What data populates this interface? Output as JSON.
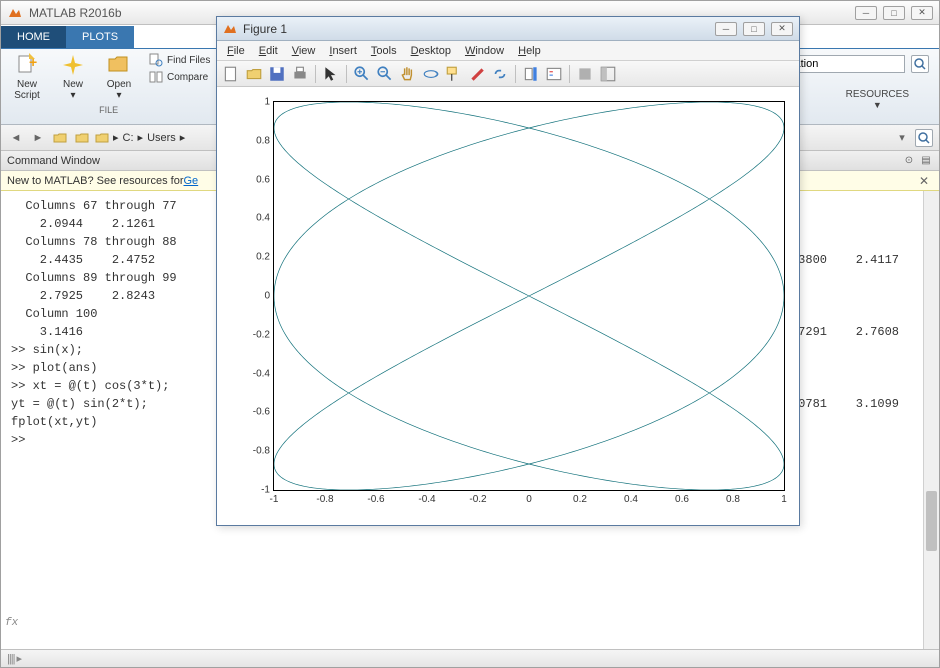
{
  "app": {
    "title": "MATLAB R2016b"
  },
  "tabs": {
    "home": "HOME",
    "plots": "PLOTS"
  },
  "toolstrip": {
    "new_script": "New\nScript",
    "new": "New",
    "open": "Open",
    "find_files": "Find Files",
    "compare": "Compare",
    "file_group": "FILE",
    "resources": "RESOURCES"
  },
  "search": {
    "placeholder": "mentation"
  },
  "nav": {
    "drive": "C:",
    "users": "Users"
  },
  "command_window": {
    "title": "Command Window",
    "hint_prefix": "New to MATLAB? See resources for ",
    "hint_link": "Ge",
    "lines": [
      "",
      "  Columns 67 through 77",
      "",
      "    2.0944    2.1261",
      "",
      "  Columns 78 through 88",
      "",
      "    2.4435    2.4752",
      "",
      "  Columns 89 through 99",
      "",
      "    2.7925    2.8243",
      "",
      "  Column 100",
      "",
      "    3.1416",
      "",
      ">> sin(x);",
      ">> plot(ans)",
      ">> xt = @(t) cos(3*t);",
      "yt = @(t) sin(2*t);",
      "fplot(xt,yt)",
      ">> "
    ],
    "right_values": [
      {
        "row": 3,
        "text": ".3800    2.4117"
      },
      {
        "row": 7,
        "text": ".7291    2.7608"
      },
      {
        "row": 11,
        "text": ".0781    3.1099"
      }
    ],
    "fx": "fx"
  },
  "figure": {
    "title": "Figure 1",
    "menus": [
      "File",
      "Edit",
      "View",
      "Insert",
      "Tools",
      "Desktop",
      "Window",
      "Help"
    ],
    "xticks": [
      -1,
      -0.8,
      -0.6,
      -0.4,
      -0.2,
      0,
      0.2,
      0.4,
      0.6,
      0.8,
      1
    ],
    "yticks": [
      -1,
      -0.8,
      -0.6,
      -0.4,
      -0.2,
      0,
      0.2,
      0.4,
      0.6,
      0.8,
      1
    ]
  },
  "chart_data": {
    "type": "line",
    "title": "",
    "xlabel": "",
    "ylabel": "",
    "xlim": [
      -1,
      1
    ],
    "ylim": [
      -1,
      1
    ],
    "parametric": true,
    "t_range": [
      0,
      6.283185307
    ],
    "x_expr": "cos(3*t)",
    "y_expr": "sin(2*t)",
    "series": [
      {
        "name": "fplot(xt,yt)",
        "color": "#10707a"
      }
    ]
  }
}
